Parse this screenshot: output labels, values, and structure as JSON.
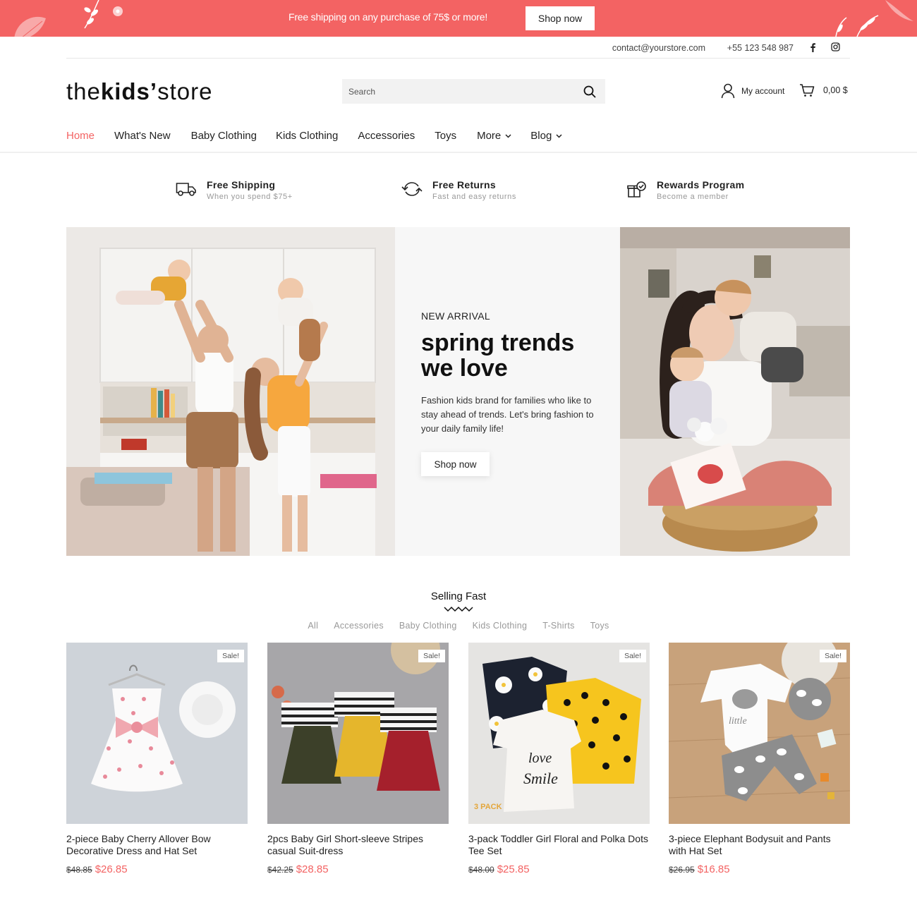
{
  "colors": {
    "accent": "#f36363",
    "text": "#222222",
    "muted": "#999999",
    "panel": "#f7f7f7"
  },
  "promo": {
    "text": "Free shipping on any purchase of 75$ or more!",
    "button": "Shop now"
  },
  "contact": {
    "email": "contact@yourstore.com",
    "phone": "+55 123 548 987",
    "icons": [
      "facebook-icon",
      "instagram-icon"
    ]
  },
  "header": {
    "logo": {
      "part1": "the",
      "part2": "kids’",
      "part3": "store"
    },
    "search_placeholder": "Search",
    "account_label": "My account",
    "cart_total": "0,00 $"
  },
  "nav": {
    "items": [
      {
        "label": "Home",
        "active": true
      },
      {
        "label": "What's New"
      },
      {
        "label": "Baby Clothing"
      },
      {
        "label": "Kids Clothing"
      },
      {
        "label": "Accessories"
      },
      {
        "label": "Toys"
      },
      {
        "label": "More",
        "dropdown": true
      },
      {
        "label": "Blog",
        "dropdown": true
      }
    ]
  },
  "features": [
    {
      "icon": "truck-icon",
      "title": "Free Shipping",
      "subtitle": "When you spend $75+"
    },
    {
      "icon": "returns-icon",
      "title": "Free Returns",
      "subtitle": "Fast and easy returns"
    },
    {
      "icon": "gift-icon",
      "title": "Rewards Program",
      "subtitle": "Become a member"
    }
  ],
  "hero": {
    "kicker": "NEW ARRIVAL",
    "title": "spring trends we love",
    "description": "Fashion kids brand for families who like to stay ahead of trends. Let's bring fashion to your daily family life!",
    "button": "Shop now"
  },
  "selling_fast": {
    "title": "Selling Fast",
    "filters": [
      "All",
      "Accessories",
      "Baby Clothing",
      "Kids Clothing",
      "T-Shirts",
      "Toys"
    ],
    "products": [
      {
        "name": "2-piece Baby Cherry Allover Bow Decorative Dress and Hat Set",
        "old_price": "$48.85",
        "price": "$26.85",
        "badge": "Sale!"
      },
      {
        "name": "2pcs Baby Girl Short-sleeve Stripes casual Suit-dress",
        "old_price": "$42.25",
        "price": "$28.85",
        "badge": "Sale!"
      },
      {
        "name": "3-pack Toddler Girl Floral and Polka Dots Tee Set",
        "old_price": "$48.00",
        "price": "$25.85",
        "badge": "Sale!",
        "image_text": "3 PACK"
      },
      {
        "name": "3-piece Elephant Bodysuit and Pants with Hat Set",
        "old_price": "$26.95",
        "price": "$16.85",
        "badge": "Sale!"
      }
    ]
  }
}
